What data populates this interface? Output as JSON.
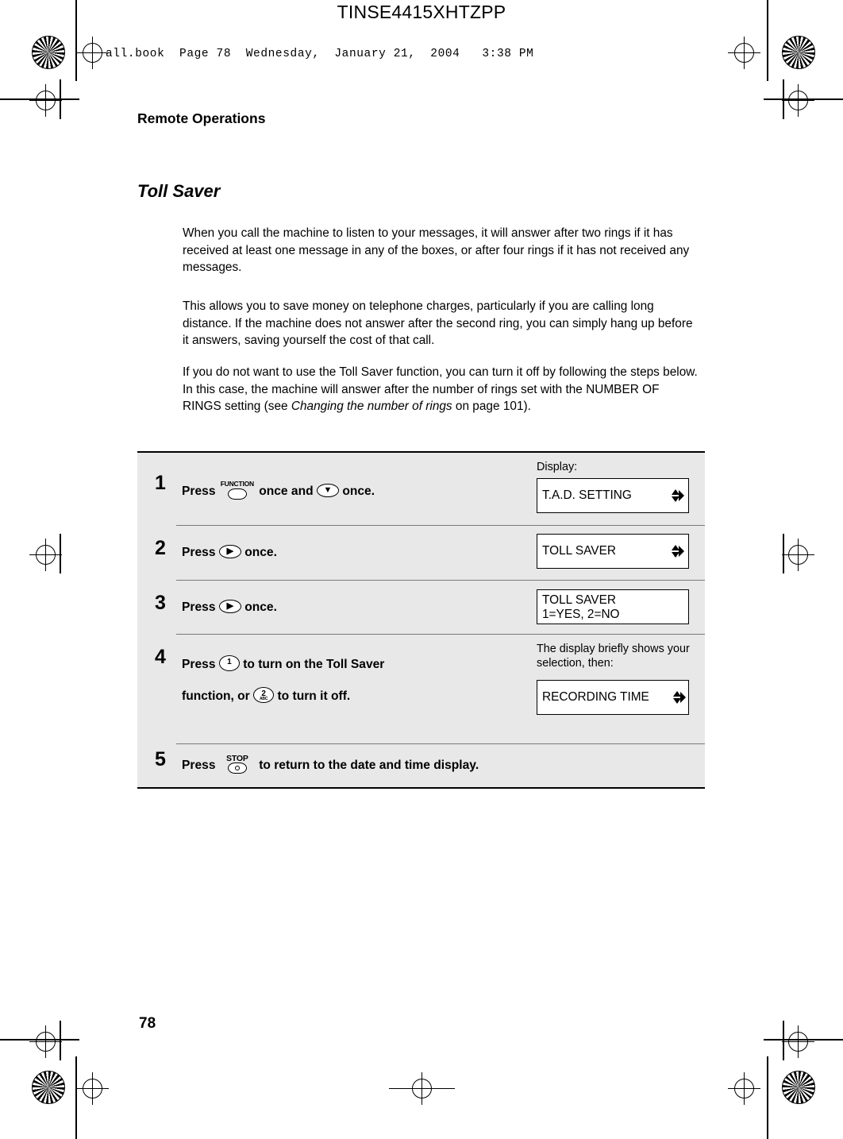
{
  "doc_code": "TINSE4415XHTZPP",
  "filestamp": "all.book  Page 78  Wednesday,  January 21,  2004   3:38 PM",
  "page_header": "Remote Operations",
  "page_number": "78",
  "section_title": "Toll Saver",
  "paragraphs": [
    "When you call the machine to listen to your messages, it will answer after two rings if it has received at least one message in any of the boxes, or after four rings if it has not received any messages.",
    "This allows you to save money on telephone charges, particularly if you are calling long distance. If the machine does not answer after the second ring, you can simply hang up before it answers, saving yourself the cost of that call."
  ],
  "paragraph3": {
    "part1": "If you do not want to use the Toll Saver function, you can turn it off by following the steps below. In this case, the machine will answer after the number of rings set with the NUMBER OF RINGS setting (see ",
    "italic": "Changing the number of rings",
    "part2": " on page 101)."
  },
  "display_column_label": "Display:",
  "steps": [
    {
      "num": "1",
      "text_before_key": "Press",
      "key1_label": "FUNCTION",
      "text_middle": "once and",
      "key2_glyph": "down-arrow-key",
      "text_after": "once.",
      "display": "T.A.D. SETTING",
      "display2": ""
    },
    {
      "num": "2",
      "text_before_key": "Press",
      "key_glyph": "right-arrow-key",
      "text_after": "once.",
      "display": "TOLL SAVER",
      "display2": ""
    },
    {
      "num": "3",
      "text_before_key": "Press",
      "key_glyph": "right-arrow-key",
      "text_after": "once.",
      "display": "TOLL SAVER",
      "display2": "1=YES, 2=NO"
    },
    {
      "num": "4",
      "line1_before": "Press",
      "key1_num": "1",
      "key1_sub": "",
      "line1_after": "to turn on the Toll Saver",
      "line2_before": "function, or",
      "key2_num": "2",
      "key2_sub": "ABC",
      "line2_after": "to turn it off.",
      "note": "The display briefly shows your selection, then:",
      "display": "RECORDING TIME"
    },
    {
      "num": "5",
      "text_before_key": "Press",
      "key_label": "STOP",
      "text_after": "to return to the date and time display."
    }
  ]
}
